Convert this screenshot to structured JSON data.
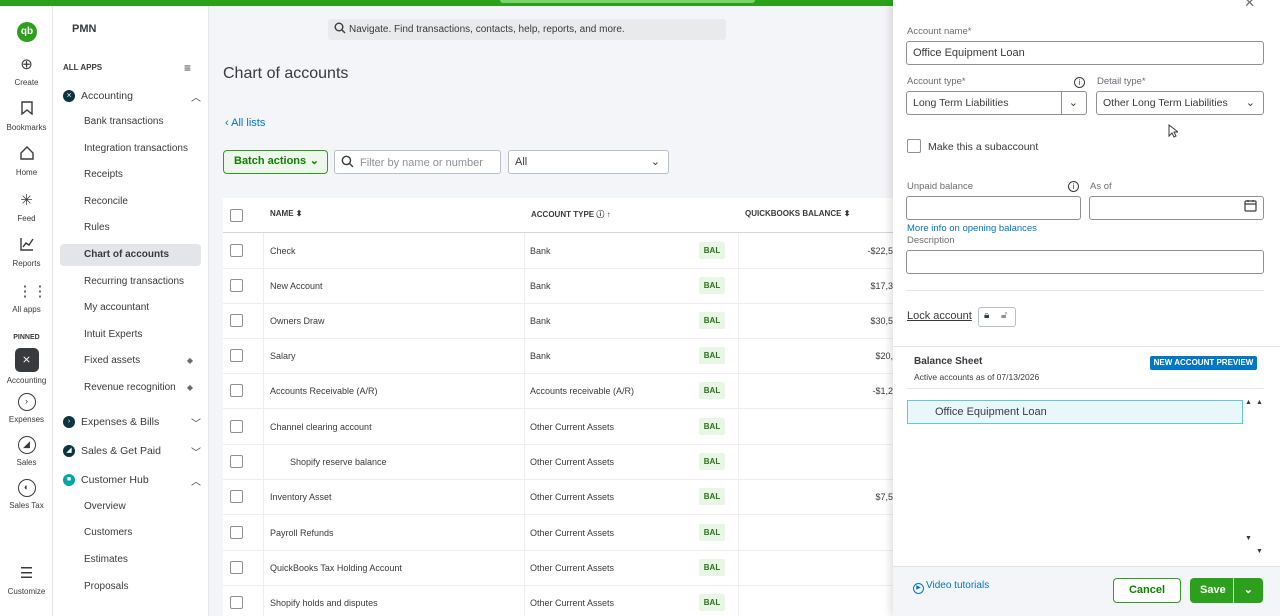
{
  "rail": {
    "logo": "qb",
    "items": [
      "Create",
      "Bookmarks",
      "Home",
      "Feed",
      "Reports",
      "All apps"
    ],
    "pinned_label": "PINNED",
    "pinned": [
      "Accounting",
      "Expenses",
      "Sales",
      "Sales Tax"
    ],
    "customize": "Customize"
  },
  "nav": {
    "company": "PMN",
    "all_apps": "ALL APPS",
    "accounting": "Accounting",
    "accounting_items": [
      "Bank transactions",
      "Integration transactions",
      "Receipts",
      "Reconcile",
      "Rules",
      "Chart of accounts",
      "Recurring transactions",
      "My accountant",
      "Intuit Experts",
      "Fixed assets",
      "Revenue recognition"
    ],
    "expenses": "Expenses & Bills",
    "sales": "Sales & Get Paid",
    "customer_hub": "Customer Hub",
    "customer_items": [
      "Overview",
      "Customers",
      "Estimates",
      "Proposals"
    ]
  },
  "search": {
    "placeholder": "Navigate. Find transactions, contacts, help, reports, and more."
  },
  "main": {
    "title": "Chart of accounts",
    "all_lists": "All lists",
    "batch_actions": "Batch actions",
    "filter_placeholder": "Filter by name or number",
    "type_filter": "All",
    "columns": {
      "name": "NAME",
      "type": "ACCOUNT TYPE",
      "balance": "QUICKBOOKS BALANCE"
    },
    "bal_badge": "BAL",
    "rows": [
      {
        "name": "Check",
        "type": "Bank",
        "amount": "-$22,5"
      },
      {
        "name": "New Account",
        "type": "Bank",
        "amount": "$17,3"
      },
      {
        "name": "Owners Draw",
        "type": "Bank",
        "amount": "$30,5"
      },
      {
        "name": "Salary",
        "type": "Bank",
        "amount": "$20,"
      },
      {
        "name": "Accounts Receivable (A/R)",
        "type": "Accounts receivable (A/R)",
        "amount": "-$1,2"
      },
      {
        "name": "Channel clearing account",
        "type": "Other Current Assets",
        "amount": ""
      },
      {
        "name": "Shopify reserve balance",
        "type": "Other Current Assets",
        "amount": ""
      },
      {
        "name": "Inventory Asset",
        "type": "Other Current Assets",
        "amount": "$7,5"
      },
      {
        "name": "Payroll Refunds",
        "type": "Other Current Assets",
        "amount": ""
      },
      {
        "name": "QuickBooks Tax Holding Account",
        "type": "Other Current Assets",
        "amount": ""
      },
      {
        "name": "Shopify holds and disputes",
        "type": "Other Current Assets",
        "amount": ""
      }
    ]
  },
  "drawer": {
    "account_name_label": "Account name*",
    "account_name_value": "Office Equipment Loan",
    "account_type_label": "Account type*",
    "account_type_value": "Long Term Liabilities",
    "detail_type_label": "Detail type*",
    "detail_type_value": "Other Long Term Liabilities",
    "subaccount_label": "Make this a subaccount",
    "unpaid_balance_label": "Unpaid balance",
    "as_of_label": "As of",
    "opening_balances_link": "More info on opening balances",
    "description_label": "Description",
    "lock_account": "Lock account",
    "balance_sheet_title": "Balance Sheet",
    "balance_sheet_sub": "Active accounts as of 07/13/2026",
    "preview_badge": "NEW ACCOUNT PREVIEW",
    "preview_item": "Office Equipment Loan",
    "video_tutorials": "Video tutorials",
    "cancel": "Cancel",
    "save": "Save"
  }
}
